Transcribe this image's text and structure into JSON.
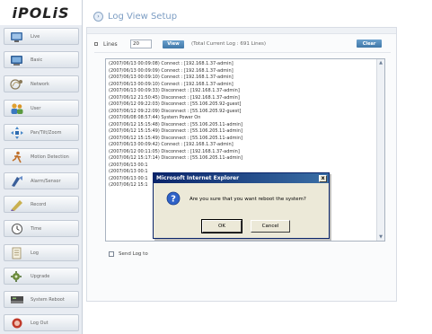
{
  "logo": "iPOLiS",
  "sidebar": {
    "items": [
      {
        "label": "Live",
        "icon": "live-camera-icon"
      },
      {
        "label": "Basic",
        "icon": "monitor-icon"
      },
      {
        "label": "Network",
        "icon": "network-icon"
      },
      {
        "label": "User",
        "icon": "users-icon"
      },
      {
        "label": "Pan/Tilt/Zoom",
        "icon": "ptz-icon"
      },
      {
        "label": "Motion Detection",
        "icon": "motion-detection-icon"
      },
      {
        "label": "Alarm/Sensor",
        "icon": "alarm-sensor-icon"
      },
      {
        "label": "Record",
        "icon": "record-icon"
      },
      {
        "label": "Time",
        "icon": "clock-icon"
      },
      {
        "label": "Log",
        "icon": "log-icon"
      },
      {
        "label": "Upgrade",
        "icon": "upgrade-icon"
      },
      {
        "label": "System Reboot",
        "icon": "system-reboot-icon"
      },
      {
        "label": "Log Out",
        "icon": "logout-icon"
      }
    ]
  },
  "header": {
    "title": "Log View Setup"
  },
  "controls": {
    "lines_label": "Lines",
    "lines_value": "20",
    "view_label": "View",
    "total_text": "(Total Current Log : 691 Lines)",
    "clear_label": "Clear"
  },
  "log": {
    "lines": [
      "(2007/06/13 00:09:08) Connect   : [192.168.1.37-admin]",
      "(2007/06/13 00:09:09) Connect   : [192.168.1.37-admin]",
      "(2007/06/13 00:09:10) Connect   : [192.168.1.37-admin]",
      "(2007/06/13 00:09:10) Connect   : [192.168.1.37-admin]",
      "(2007/06/13 00:09:33) Disconnect : [192.168.1.37-admin]",
      "(2007/06/12 21:50:45) Disconnect : [192.168.1.37-admin]",
      "(2007/06/12 09:22:03) Disconnect : [55.106.205.92-guest]",
      "(2007/06/12 09:22:09) Disconnect : [55.106.205.92-guest]",
      "(2007/06/08 08:57:44) System Power On",
      "(2007/06/12 15:15:48) Disconnect : [55.106.205.11-admin]",
      "(2007/06/12 15:15:49) Disconnect : [55.106.205.11-admin]",
      "(2007/06/12 15:15:49) Disconnect : [55.106.205.11-admin]",
      "(2007/06/13 00:09:42) Connect   : [192.168.1.37-admin]",
      "(2007/06/12 00:11:05) Disconnect : [192.168.1.37-admin]",
      "(2007/06/12 15:17:14) Disconnect : [55.106.205.11-admin]",
      "(2007/06/13 00:1",
      "(2007/06/13 00:1",
      "(2007/06/13 00:1",
      "(2007/06/12 15:1"
    ]
  },
  "send_log": {
    "label": "Send Log to"
  },
  "dialog": {
    "title": "Microsoft Internet Explorer",
    "close_glyph": "x",
    "message": "Are you sure that you want reboot the system?",
    "ok_label": "OK",
    "cancel_label": "Cancel",
    "icon": "question-icon"
  },
  "colors": {
    "accent": "#4a86b8",
    "header_title": "#7c9dc3",
    "dialog_titlebar": "#0a246a"
  }
}
